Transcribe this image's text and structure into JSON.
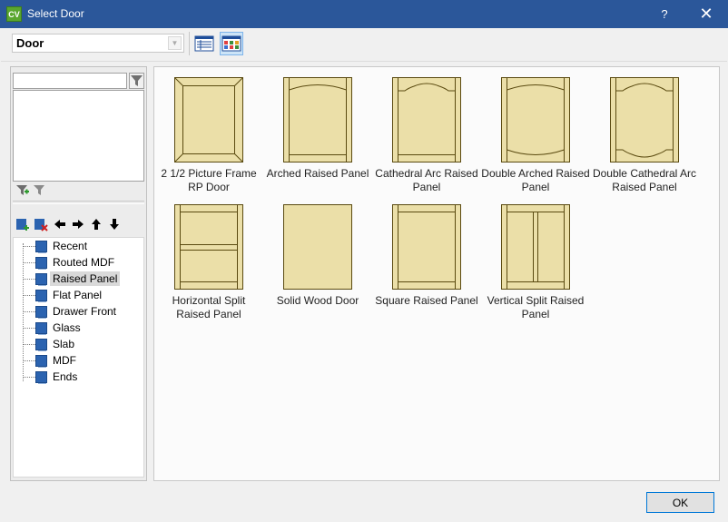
{
  "window": {
    "title": "Select Door",
    "app_badge": "CV",
    "help_label": "?",
    "close_label": "✕"
  },
  "toolbar": {
    "type_value": "Door",
    "dropdown_arrow": "▼"
  },
  "filters": {
    "search_value": ""
  },
  "tree": {
    "items": [
      {
        "label": "Recent"
      },
      {
        "label": "Routed MDF"
      },
      {
        "label": "Raised Panel"
      },
      {
        "label": "Flat Panel"
      },
      {
        "label": "Drawer Front"
      },
      {
        "label": "Glass"
      },
      {
        "label": "Slab"
      },
      {
        "label": "MDF"
      },
      {
        "label": "Ends"
      }
    ]
  },
  "gallery": {
    "items": [
      {
        "label": "2 1/2 Picture Frame RP Door",
        "icon": "picture-frame-door-icon"
      },
      {
        "label": "Arched Raised Panel",
        "icon": "arched-door-icon"
      },
      {
        "label": "Cathedral Arc Raised Panel",
        "icon": "cathedral-door-icon"
      },
      {
        "label": "Double Arched Raised Panel",
        "icon": "double-arched-door-icon"
      },
      {
        "label": "Double Cathedral Arc Raised Panel",
        "icon": "double-cathedral-door-icon"
      },
      {
        "label": "Horizontal Split Raised Panel",
        "icon": "horizontal-split-door-icon"
      },
      {
        "label": "Solid Wood Door",
        "icon": "solid-wood-door-icon"
      },
      {
        "label": "Square Raised Panel",
        "icon": "square-door-icon"
      },
      {
        "label": "Vertical Split Raised Panel",
        "icon": "vertical-split-door-icon"
      }
    ]
  },
  "footer": {
    "ok_label": "OK"
  },
  "colors": {
    "titlebar": "#2b579a",
    "door_fill": "#ebdfa8",
    "door_outline": "#5a4a10",
    "folder": "#2b63b0"
  }
}
